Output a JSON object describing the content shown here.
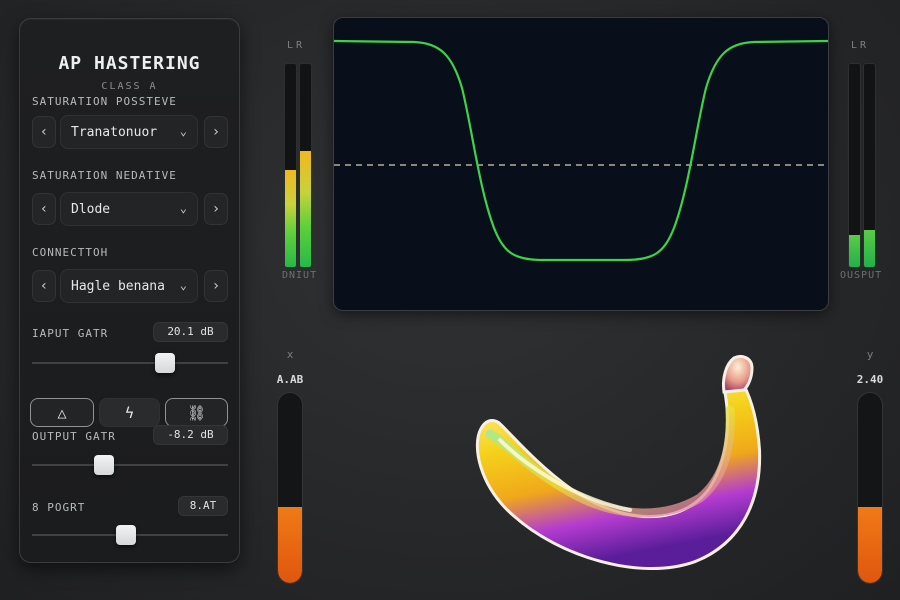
{
  "plugin": {
    "title": "AP HASTERING",
    "subtitle": "CLASS A"
  },
  "sections": {
    "saturation_positive": {
      "label": "SATURATION POSSTEVE",
      "value": "Tranatonuor"
    },
    "saturation_negative": {
      "label": "SATURATION NEDATIVE",
      "value": "Dlode"
    },
    "connection": {
      "label": "CONNECTTOH",
      "value": "Hagle benana"
    }
  },
  "nav": {
    "prev": "‹",
    "next": "›",
    "chevron": "⌄"
  },
  "input_gain": {
    "label": "IAPUT GATR",
    "value": "20.1 dB",
    "position": 0.7
  },
  "mode_buttons": [
    {
      "name": "triangle-mode",
      "glyph": "△"
    },
    {
      "name": "lightning-mode",
      "glyph": "ϟ"
    },
    {
      "name": "link-mode",
      "glyph": "⛓"
    }
  ],
  "output_gain": {
    "label": "OUTPUT GATR",
    "value": "-8.2 dB",
    "position": 0.35
  },
  "third_param": {
    "label": "8 POGRT",
    "value": "8.AT",
    "position": 0.48
  },
  "input_meter": {
    "channels": "LR",
    "caption": "DNIUT",
    "left_level": 0.48,
    "right_level": 0.57
  },
  "output_meter": {
    "channels": "LR",
    "caption": "OUSPUT",
    "left_level": 0.16,
    "right_level": 0.18
  },
  "x_control": {
    "label": "x",
    "value": "A.AB",
    "level": 0.4
  },
  "y_control": {
    "label": "y",
    "value": "2.40",
    "level": 0.4
  },
  "colors": {
    "curve": "#3ed24a",
    "dashed_midline": "#d9c9b6",
    "fader_orange": "#ea6a12",
    "scope_bg": "#080f1a"
  },
  "icons": {
    "banana": "banana-icon"
  }
}
